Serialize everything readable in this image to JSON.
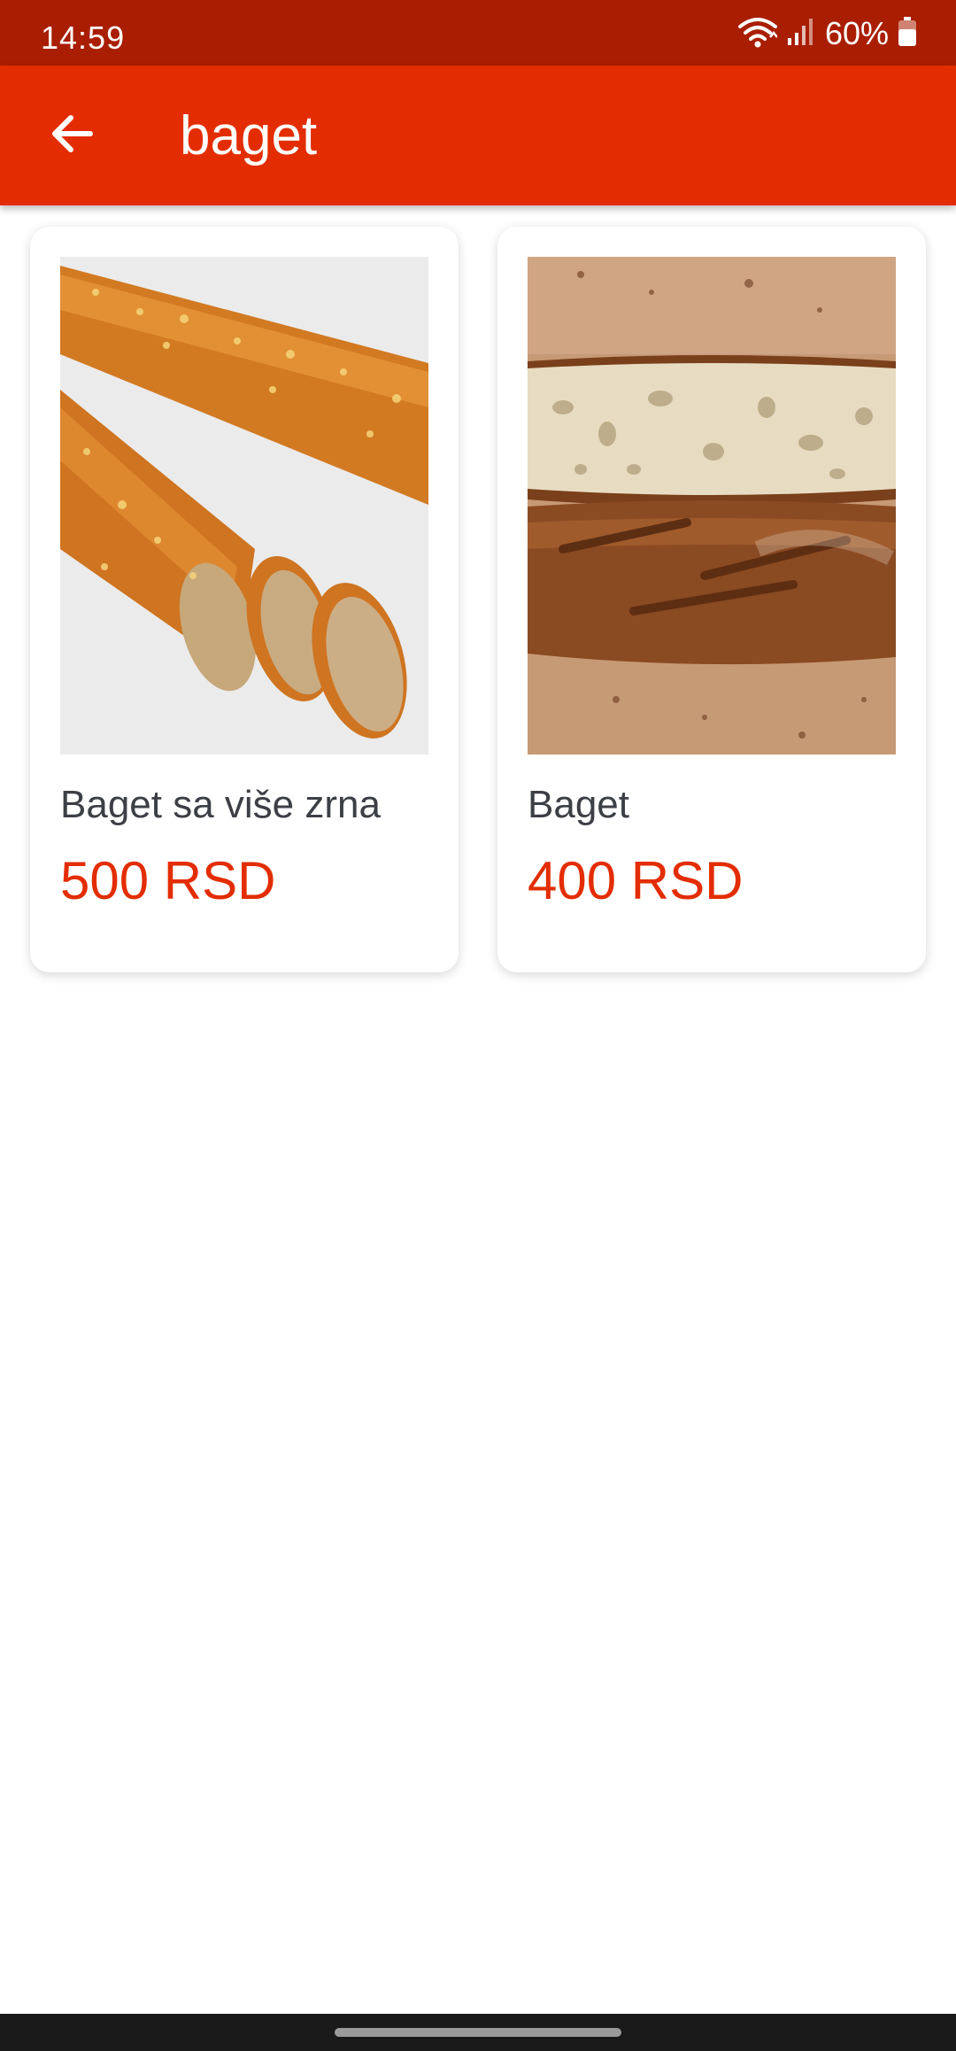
{
  "status_bar": {
    "time": "14:59",
    "battery_percent": "60%",
    "icons": [
      "wifi-icon",
      "signal-icon",
      "battery-icon"
    ]
  },
  "app_bar": {
    "title": "baget",
    "back_icon": "arrow-left-icon"
  },
  "colors": {
    "primary": "#e32d00",
    "status_bar": "#a91e00",
    "title_text": "#3c3f45",
    "price_text": "#e32d00"
  },
  "products": [
    {
      "name": "Baget sa više zrna",
      "price": "500 RSD",
      "image": "multigrain-baguette-photo"
    },
    {
      "name": "Baget",
      "price": "400 RSD",
      "image": "baguette-photo"
    }
  ]
}
